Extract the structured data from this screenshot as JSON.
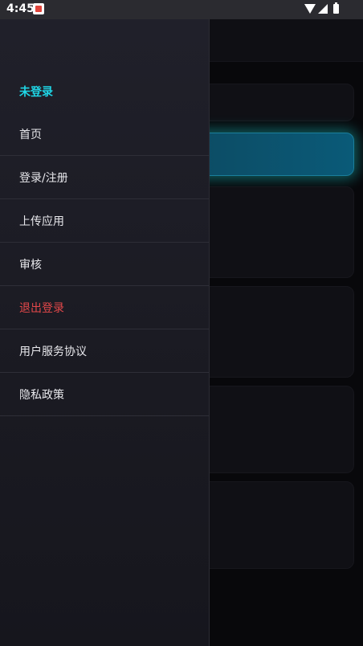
{
  "status_bar": {
    "time": "4:45",
    "icons": [
      "app-notification-icon",
      "wifi-icon",
      "signal-icon",
      "battery-icon"
    ]
  },
  "drawer": {
    "user_status": "未登录",
    "items": [
      {
        "label": "首页"
      },
      {
        "label": "登录/注册"
      },
      {
        "label": "上传应用"
      },
      {
        "label": "审核"
      },
      {
        "label": "退出登录"
      },
      {
        "label": "用户服务协议"
      },
      {
        "label": "隐私政策"
      }
    ]
  },
  "colors": {
    "accent": "#1fd6e6",
    "danger": "#e4484a",
    "drawer_bg": "#1b1b23",
    "text": "#e8e8ec"
  }
}
